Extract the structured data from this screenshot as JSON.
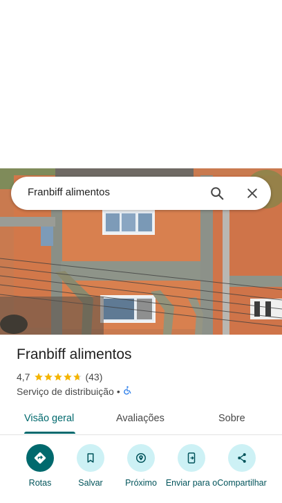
{
  "search": {
    "query": "Franbiff alimentos"
  },
  "place": {
    "name": "Franbiff alimentos",
    "rating": "4,7",
    "rating_value": 4.7,
    "review_count": "(43)",
    "category": "Serviço de distribuição",
    "separator": "•",
    "accessibility_icon": "wheelchair-accessible-icon"
  },
  "tabs": [
    {
      "label": "Visão geral",
      "active": true
    },
    {
      "label": "Avaliações",
      "active": false
    },
    {
      "label": "Sobre",
      "active": false
    }
  ],
  "actions": [
    {
      "label": "Rotas",
      "icon": "directions-icon"
    },
    {
      "label": "Salvar",
      "icon": "bookmark-icon"
    },
    {
      "label": "Próximo",
      "icon": "nearby-icon"
    },
    {
      "label": "Enviar para o",
      "icon": "send-to-phone-icon"
    },
    {
      "label": "Compartilhar",
      "icon": "share-icon"
    }
  ],
  "colors": {
    "accent": "#00696d",
    "action_bg": "#cdf1f5",
    "star": "#f4b400"
  }
}
